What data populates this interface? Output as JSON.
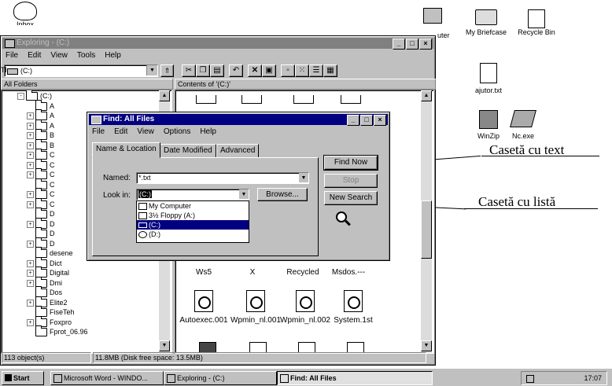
{
  "desktop": {
    "icons": [
      "Inbox",
      "uter",
      "My Briefcase",
      "Recycle Bin",
      "ajutor.txt",
      "WinZip",
      "Nc.exe"
    ]
  },
  "explorer": {
    "title": "Exploring - (C:)",
    "menu": [
      "File",
      "Edit",
      "View",
      "Tools",
      "Help"
    ],
    "address": "(C:)",
    "left_header": "All Folders",
    "right_header": "Contents of '(C:)'",
    "tree": [
      {
        "label": "(C:)",
        "expand": "-"
      },
      {
        "label": "A",
        "expand": ""
      },
      {
        "label": "A",
        "expand": "+"
      },
      {
        "label": "A",
        "expand": "+"
      },
      {
        "label": "B",
        "expand": "+"
      },
      {
        "label": "B",
        "expand": "+"
      },
      {
        "label": "C",
        "expand": "+"
      },
      {
        "label": "C",
        "expand": "+"
      },
      {
        "label": "C",
        "expand": "+"
      },
      {
        "label": "C",
        "expand": ""
      },
      {
        "label": "C",
        "expand": "+"
      },
      {
        "label": "C",
        "expand": "+"
      },
      {
        "label": "D",
        "expand": ""
      },
      {
        "label": "D",
        "expand": "+"
      },
      {
        "label": "D",
        "expand": ""
      },
      {
        "label": "D",
        "expand": "+"
      },
      {
        "label": "desene",
        "expand": ""
      },
      {
        "label": "Dict",
        "expand": "+"
      },
      {
        "label": "Digital",
        "expand": "+"
      },
      {
        "label": "Dmi",
        "expand": "+"
      },
      {
        "label": "Dos",
        "expand": ""
      },
      {
        "label": "Elite2",
        "expand": "+"
      },
      {
        "label": "FiseTeh",
        "expand": ""
      },
      {
        "label": "Foxpro",
        "expand": "+"
      },
      {
        "label": "Fprot_06.96",
        "expand": ""
      }
    ],
    "files_row1": [
      "Ws5",
      "X",
      "Recycled",
      "Msdos.---"
    ],
    "files_row2": [
      "Autoexec.001",
      "Wpmin_nl.001",
      "Wpmin_nl.002",
      "System.1st"
    ],
    "status_left": "113 object(s)",
    "status_right": "11.8MB (Disk free space: 13.5MB)"
  },
  "find": {
    "title": "Find: All Files",
    "menu": [
      "File",
      "Edit",
      "View",
      "Options",
      "Help"
    ],
    "tabs": [
      "Name & Location",
      "Date Modified",
      "Advanced"
    ],
    "named_label": "Named:",
    "named_value": "*.txt",
    "lookin_label": "Look in:",
    "lookin_value": "(C:)",
    "browse": "Browse...",
    "find_now": "Find Now",
    "stop": "Stop",
    "new_search": "New Search",
    "dropdown": [
      "My Computer",
      "3½ Floppy (A:)",
      "(C:)",
      "(D:)"
    ]
  },
  "annotations": {
    "text_box": "Casetă cu text",
    "list_box": "Casetă cu listă"
  },
  "taskbar": {
    "start": "Start",
    "tasks": [
      "Microsoft Word - WINDO...",
      "Exploring - (C:)",
      "Find: All Files"
    ],
    "clock": "17:07"
  }
}
